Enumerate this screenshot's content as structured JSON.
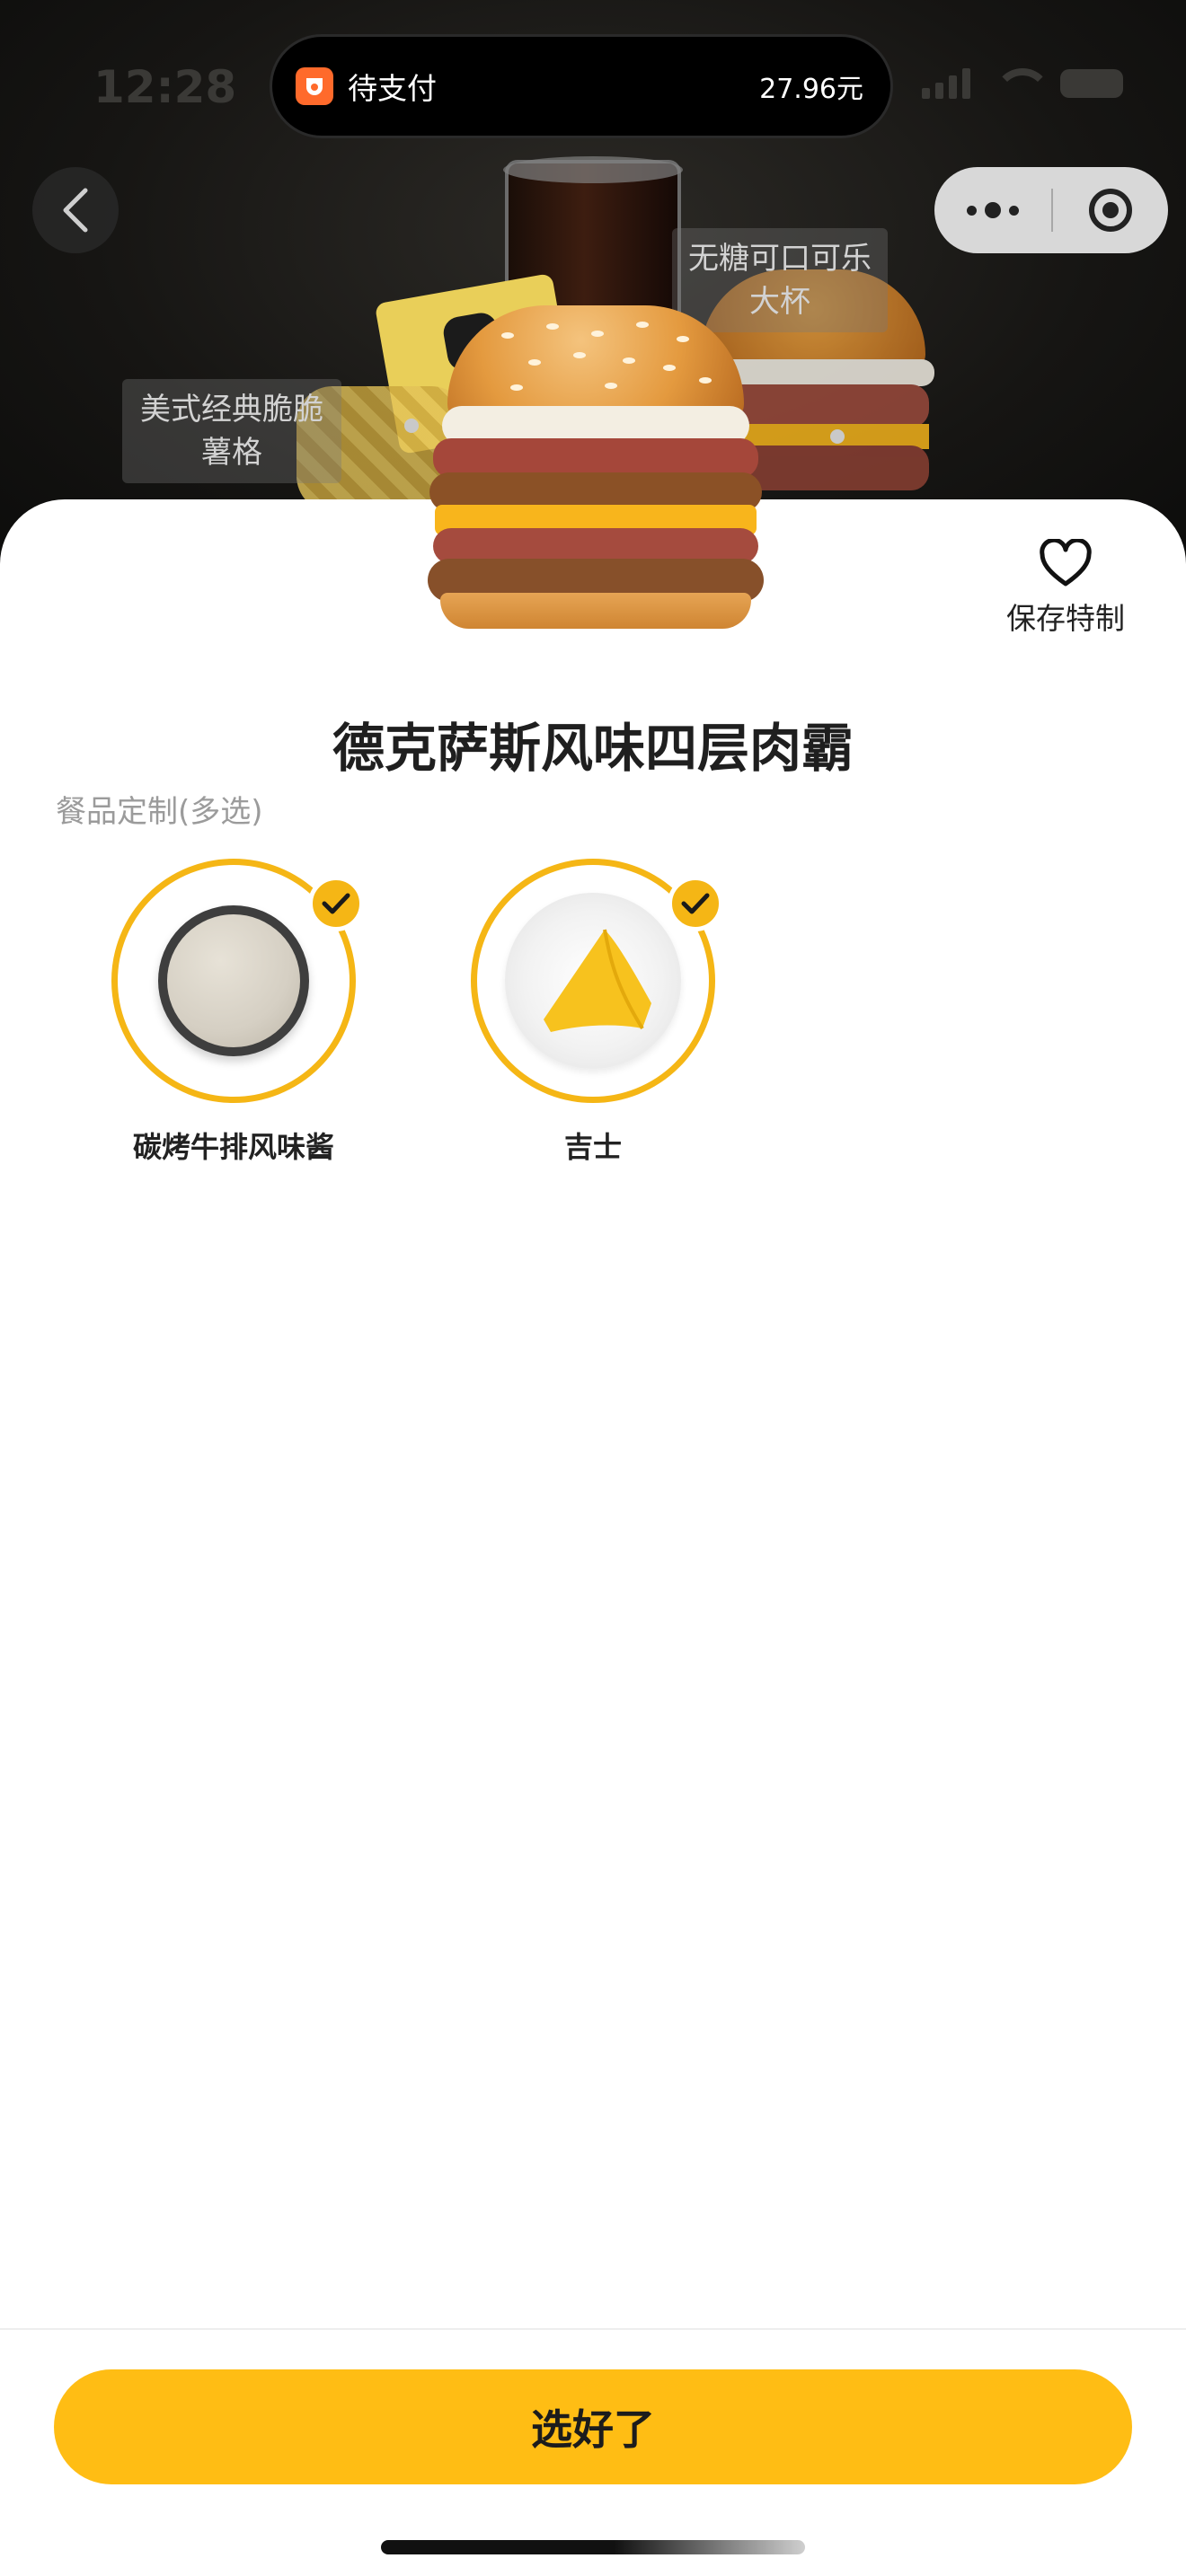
{
  "status_bar": {
    "time": "12:28"
  },
  "pending_payment": {
    "label": "待支付",
    "amount": "27.96元"
  },
  "hero": {
    "food_tags": [
      {
        "label": "美式经典脆脆\n薯格"
      },
      {
        "label": "无糖可口可乐\n大杯"
      }
    ]
  },
  "save_special": {
    "label": "保存特制"
  },
  "product": {
    "name": "德克萨斯风味四层肉霸"
  },
  "customization": {
    "heading": "餐品定制(多选)",
    "options": [
      {
        "label": "碳烤牛排风味酱",
        "selected": true
      },
      {
        "label": "吉士",
        "selected": true
      }
    ]
  },
  "confirm": {
    "label": "选好了"
  },
  "colors": {
    "accent": "#ffbd14",
    "ring": "#f5b615",
    "heart": "#111111"
  }
}
